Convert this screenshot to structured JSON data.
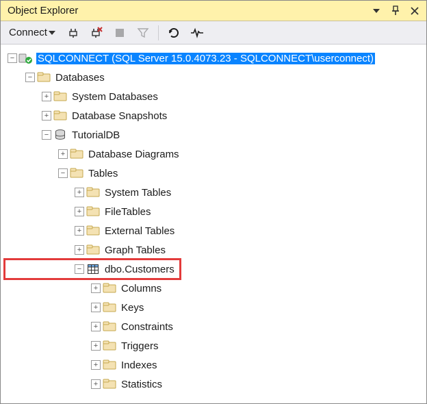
{
  "title": "Object Explorer",
  "toolbar": {
    "connect_label": "Connect"
  },
  "tree": {
    "root": "SQLCONNECT (SQL Server 15.0.4073.23 - SQLCONNECT\\userconnect)",
    "databases": "Databases",
    "system_databases": "System Databases",
    "database_snapshots": "Database Snapshots",
    "tutorialdb": "TutorialDB",
    "database_diagrams": "Database Diagrams",
    "tables": "Tables",
    "system_tables": "System Tables",
    "filetables": "FileTables",
    "external_tables": "External Tables",
    "graph_tables": "Graph Tables",
    "dbo_customers": "dbo.Customers",
    "columns": "Columns",
    "keys": "Keys",
    "constraints": "Constraints",
    "triggers": "Triggers",
    "indexes": "Indexes",
    "statistics": "Statistics"
  }
}
